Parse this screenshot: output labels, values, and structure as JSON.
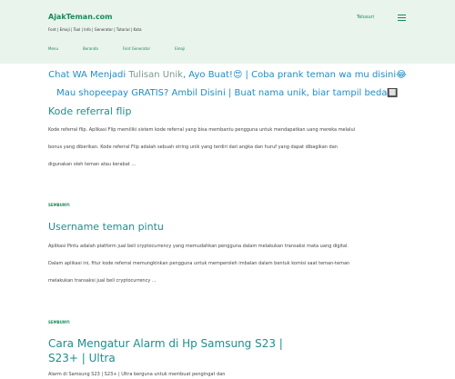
{
  "header": {
    "site_title": "AjakTeman.com",
    "tagline": "Font | Emoji | Tool | Info | Generator | Tutorial | Kata",
    "search_label": "Telusuri",
    "menu_icon": "hamburger-menu-icon"
  },
  "nav": {
    "items": [
      {
        "label": "Menu"
      },
      {
        "label": "Beranda"
      },
      {
        "label": "Font Generator"
      },
      {
        "label": "Emoji"
      }
    ]
  },
  "ticker": {
    "line1_a": "Chat WA Menjadi ",
    "line1_em": "Tulisan Unik",
    "line1_b": ", Ayo Buat!😍 | Coba prank teman wa mu disini😂",
    "line2": "Mau shopeepay GRATIS? Ambil Disini | Buat nama unik, biar tampil beda🔲"
  },
  "posts": [
    {
      "title": "Kode referral flip",
      "excerpt": "Kode referral flip. Aplikasi Flip memiliki sistem kode referral yang bisa membantu pengguna untuk mendapatkan uang mereka melalui bonus yang diberikan. Kode referral Flip adalah sebuah string unik yang terdiri dari angka dan huruf yang dapat dibagikan dan digunakan oleh teman atau kerabat",
      "ellipsis": "…",
      "read_more": "SEMBUNYI"
    },
    {
      "title": "Username teman pintu",
      "excerpt": "Aplikasi Pintu adalah platform jual beli cryptocurrency yang memudahkan pengguna dalam melakukan transaksi mata uang digital. Dalam aplikasi ini, fitur kode referral memungkinkan pengguna untuk memperoleh imbalan dalam bentuk komisi saat teman-teman melakukan transaksi jual beli cryptocurrency",
      "ellipsis": "…",
      "read_more": "SEMBUNYI"
    },
    {
      "title_line1": "Cara Mengatur Alarm di Hp Samsung S23 |",
      "title_line2": "S23+ | Ultra",
      "excerpt": "Alarm di Samsung S23 | S23+ | Ultra berguna untuk membuat pengingat dan"
    }
  ]
}
